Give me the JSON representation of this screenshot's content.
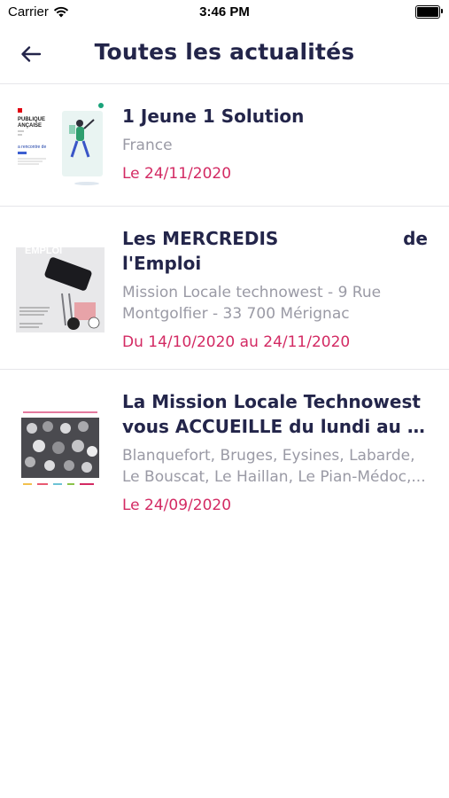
{
  "status_bar": {
    "carrier": "Carrier",
    "time": "3:46 PM"
  },
  "nav": {
    "title": "Toutes les actualités"
  },
  "news": [
    {
      "title_lines": [
        "1 Jeune 1 Solution"
      ],
      "location_lines": [
        "France"
      ],
      "date": "Le 24/11/2020",
      "thumb_texts": [
        "PUBLIQUE",
        "ANÇAISE",
        "a rencontre de"
      ]
    },
    {
      "title_parts": [
        "Les MERCREDIS",
        "de"
      ],
      "title_line2": "l'Emploi",
      "location_lines": [
        "Mission Locale technowest - 9 Rue",
        "Montgolfier - 33 700 Mérignac"
      ],
      "date": "Du 14/10/2020 au 24/11/2020",
      "thumb_texts": [
        "EMPLOI"
      ]
    },
    {
      "title_lines": [
        "La Mission Locale Technowest",
        "vous ACCUEILLE du lundi au ve..."
      ],
      "location_lines": [
        "Blanquefort, Bruges, Eysines, Labarde,",
        "Le Bouscat, Le Haillan, Le Pian-Médoc,..."
      ],
      "date": "Le 24/09/2020"
    }
  ],
  "colors": {
    "title": "#23254a",
    "meta": "#9a9aa5",
    "date": "#d32a63",
    "divider": "#e6e6ea"
  }
}
